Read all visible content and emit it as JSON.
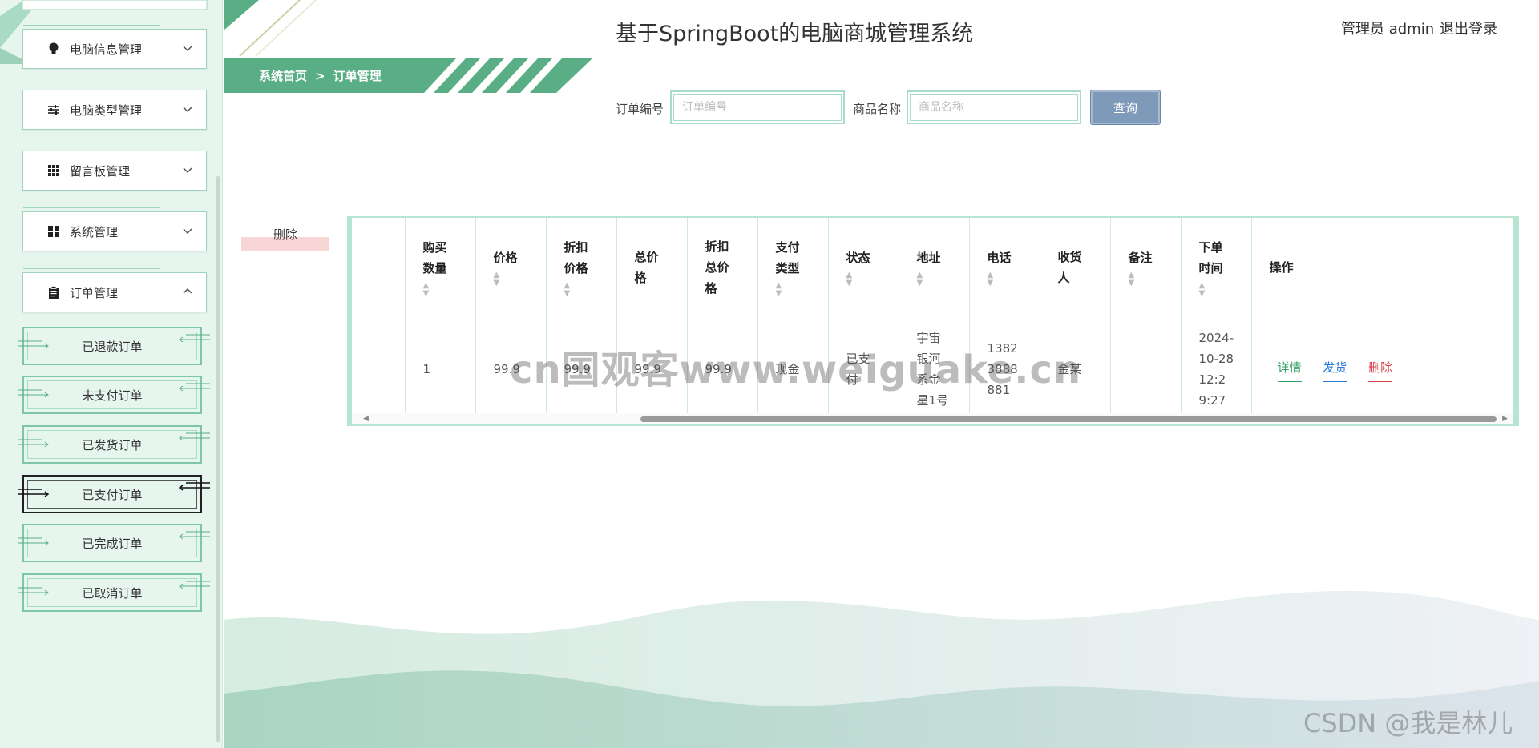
{
  "app_title": "基于SpringBoot的电脑商城管理系统",
  "header": {
    "admin_text": "管理员 admin",
    "logout": "退出登录"
  },
  "breadcrumb": {
    "home": "系统首页",
    "separator": ">",
    "current": "订单管理"
  },
  "sidebar": {
    "menus": [
      {
        "label": "电脑信息管理",
        "icon": "bulb-icon"
      },
      {
        "label": "电脑类型管理",
        "icon": "sliders-icon"
      },
      {
        "label": "留言板管理",
        "icon": "grid-icon"
      },
      {
        "label": "系统管理",
        "icon": "apps-icon"
      },
      {
        "label": "订单管理",
        "icon": "clipboard-icon"
      }
    ],
    "submenu": [
      "已退款订单",
      "未支付订单",
      "已发货订单",
      "已支付订单",
      "已完成订单",
      "已取消订单"
    ],
    "active_submenu": "已支付订单"
  },
  "search": {
    "order_no_label": "订单编号",
    "order_no_placeholder": "订单编号",
    "product_label": "商品名称",
    "product_placeholder": "商品名称",
    "button": "查询"
  },
  "batch_delete": "删除",
  "table": {
    "columns": [
      "",
      "购买数量",
      "价格",
      "折扣价格",
      "总价格",
      "折扣总价格",
      "支付类型",
      "状态",
      "地址",
      "电话",
      "收货人",
      "备注",
      "下单时间",
      "操作"
    ],
    "rows": [
      {
        "quantity": "1",
        "price": "99.9",
        "discount_price": "99.9",
        "total": "99.9",
        "discount_total": "99.9",
        "pay_type": "现金",
        "status": "已支付",
        "address": "宇宙银河系金星1号",
        "phone": "13823888881",
        "receiver": "金某",
        "remark": "",
        "order_time": "2024-10-28 12:29:27"
      }
    ],
    "actions": {
      "detail": "详情",
      "ship": "发货",
      "delete": "删除"
    }
  },
  "watermark": "cn国观客www.weiguake.cn",
  "csdn_watermark": "CSDN @我是林儿",
  "colors": {
    "accent_green": "#5aae85",
    "sidebar_bg": "#e6f5ee",
    "button_blue": "#7f9ab8",
    "delete_red": "#d9444d"
  }
}
